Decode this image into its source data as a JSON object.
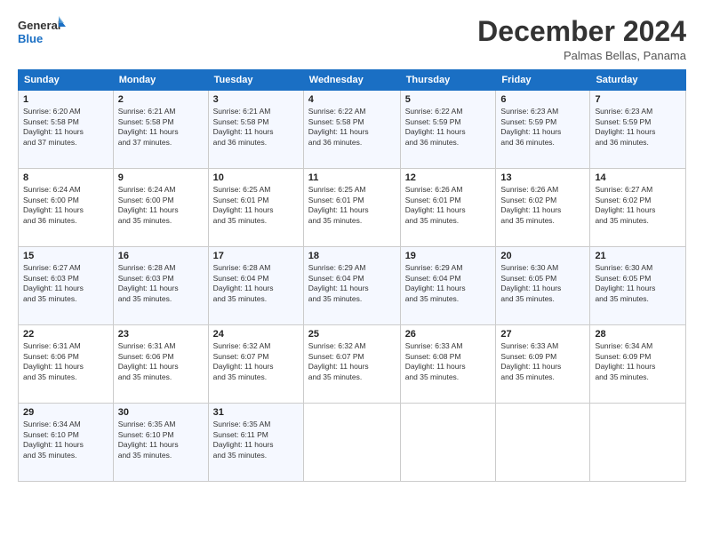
{
  "header": {
    "logo_line1": "General",
    "logo_line2": "Blue",
    "month_title": "December 2024",
    "location": "Palmas Bellas, Panama"
  },
  "days_of_week": [
    "Sunday",
    "Monday",
    "Tuesday",
    "Wednesday",
    "Thursday",
    "Friday",
    "Saturday"
  ],
  "weeks": [
    [
      {
        "day": "1",
        "info": "Sunrise: 6:20 AM\nSunset: 5:58 PM\nDaylight: 11 hours\nand 37 minutes."
      },
      {
        "day": "2",
        "info": "Sunrise: 6:21 AM\nSunset: 5:58 PM\nDaylight: 11 hours\nand 37 minutes."
      },
      {
        "day": "3",
        "info": "Sunrise: 6:21 AM\nSunset: 5:58 PM\nDaylight: 11 hours\nand 36 minutes."
      },
      {
        "day": "4",
        "info": "Sunrise: 6:22 AM\nSunset: 5:58 PM\nDaylight: 11 hours\nand 36 minutes."
      },
      {
        "day": "5",
        "info": "Sunrise: 6:22 AM\nSunset: 5:59 PM\nDaylight: 11 hours\nand 36 minutes."
      },
      {
        "day": "6",
        "info": "Sunrise: 6:23 AM\nSunset: 5:59 PM\nDaylight: 11 hours\nand 36 minutes."
      },
      {
        "day": "7",
        "info": "Sunrise: 6:23 AM\nSunset: 5:59 PM\nDaylight: 11 hours\nand 36 minutes."
      }
    ],
    [
      {
        "day": "8",
        "info": "Sunrise: 6:24 AM\nSunset: 6:00 PM\nDaylight: 11 hours\nand 36 minutes."
      },
      {
        "day": "9",
        "info": "Sunrise: 6:24 AM\nSunset: 6:00 PM\nDaylight: 11 hours\nand 35 minutes."
      },
      {
        "day": "10",
        "info": "Sunrise: 6:25 AM\nSunset: 6:01 PM\nDaylight: 11 hours\nand 35 minutes."
      },
      {
        "day": "11",
        "info": "Sunrise: 6:25 AM\nSunset: 6:01 PM\nDaylight: 11 hours\nand 35 minutes."
      },
      {
        "day": "12",
        "info": "Sunrise: 6:26 AM\nSunset: 6:01 PM\nDaylight: 11 hours\nand 35 minutes."
      },
      {
        "day": "13",
        "info": "Sunrise: 6:26 AM\nSunset: 6:02 PM\nDaylight: 11 hours\nand 35 minutes."
      },
      {
        "day": "14",
        "info": "Sunrise: 6:27 AM\nSunset: 6:02 PM\nDaylight: 11 hours\nand 35 minutes."
      }
    ],
    [
      {
        "day": "15",
        "info": "Sunrise: 6:27 AM\nSunset: 6:03 PM\nDaylight: 11 hours\nand 35 minutes."
      },
      {
        "day": "16",
        "info": "Sunrise: 6:28 AM\nSunset: 6:03 PM\nDaylight: 11 hours\nand 35 minutes."
      },
      {
        "day": "17",
        "info": "Sunrise: 6:28 AM\nSunset: 6:04 PM\nDaylight: 11 hours\nand 35 minutes."
      },
      {
        "day": "18",
        "info": "Sunrise: 6:29 AM\nSunset: 6:04 PM\nDaylight: 11 hours\nand 35 minutes."
      },
      {
        "day": "19",
        "info": "Sunrise: 6:29 AM\nSunset: 6:04 PM\nDaylight: 11 hours\nand 35 minutes."
      },
      {
        "day": "20",
        "info": "Sunrise: 6:30 AM\nSunset: 6:05 PM\nDaylight: 11 hours\nand 35 minutes."
      },
      {
        "day": "21",
        "info": "Sunrise: 6:30 AM\nSunset: 6:05 PM\nDaylight: 11 hours\nand 35 minutes."
      }
    ],
    [
      {
        "day": "22",
        "info": "Sunrise: 6:31 AM\nSunset: 6:06 PM\nDaylight: 11 hours\nand 35 minutes."
      },
      {
        "day": "23",
        "info": "Sunrise: 6:31 AM\nSunset: 6:06 PM\nDaylight: 11 hours\nand 35 minutes."
      },
      {
        "day": "24",
        "info": "Sunrise: 6:32 AM\nSunset: 6:07 PM\nDaylight: 11 hours\nand 35 minutes."
      },
      {
        "day": "25",
        "info": "Sunrise: 6:32 AM\nSunset: 6:07 PM\nDaylight: 11 hours\nand 35 minutes."
      },
      {
        "day": "26",
        "info": "Sunrise: 6:33 AM\nSunset: 6:08 PM\nDaylight: 11 hours\nand 35 minutes."
      },
      {
        "day": "27",
        "info": "Sunrise: 6:33 AM\nSunset: 6:09 PM\nDaylight: 11 hours\nand 35 minutes."
      },
      {
        "day": "28",
        "info": "Sunrise: 6:34 AM\nSunset: 6:09 PM\nDaylight: 11 hours\nand 35 minutes."
      }
    ],
    [
      {
        "day": "29",
        "info": "Sunrise: 6:34 AM\nSunset: 6:10 PM\nDaylight: 11 hours\nand 35 minutes."
      },
      {
        "day": "30",
        "info": "Sunrise: 6:35 AM\nSunset: 6:10 PM\nDaylight: 11 hours\nand 35 minutes."
      },
      {
        "day": "31",
        "info": "Sunrise: 6:35 AM\nSunset: 6:11 PM\nDaylight: 11 hours\nand 35 minutes."
      },
      {
        "day": "",
        "info": ""
      },
      {
        "day": "",
        "info": ""
      },
      {
        "day": "",
        "info": ""
      },
      {
        "day": "",
        "info": ""
      }
    ]
  ]
}
